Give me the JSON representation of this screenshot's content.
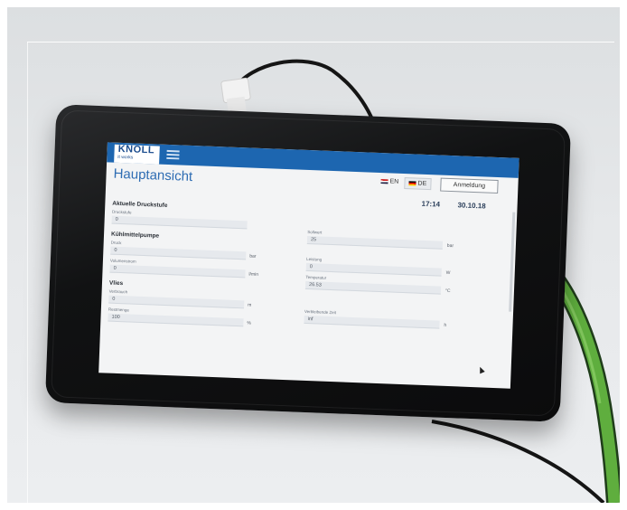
{
  "header": {
    "logo": "KNOLL",
    "logo_sub": "it works",
    "title": "Hauptansicht",
    "lang_en": "EN",
    "lang_de": "DE",
    "login": "Anmeldung",
    "time": "17:14",
    "date": "30.10.18"
  },
  "sections": {
    "druckstufe": "Aktuelle Druckstufe",
    "pumpe": "Kühlmittelpumpe",
    "vlies": "Vlies"
  },
  "left": {
    "druckstufe_label": "Druckstufe",
    "druckstufe_value": "0",
    "druck_label": "Druck",
    "druck_value": "0",
    "druck_unit": "bar",
    "volumen_label": "Volumenstrom",
    "volumen_value": "0",
    "volumen_unit": "l/min",
    "verbrauch_label": "Verbrauch",
    "verbrauch_value": "0",
    "verbrauch_unit": "m",
    "rest_label": "Restmenge",
    "rest_value": "100",
    "rest_unit": "%"
  },
  "right": {
    "sollwert_label": "Sollwert",
    "sollwert_value": "25",
    "sollwert_unit": "bar",
    "leistung_label": "Leistung",
    "leistung_value": "0",
    "leistung_unit": "W",
    "temp_label": "Temperatur",
    "temp_value": "26.53",
    "temp_unit": "°C",
    "zeit_label": "Verbleibende Zeit",
    "zeit_value": "inf",
    "zeit_unit": "h"
  },
  "colors": {
    "topbar": "#1d66b0",
    "cable_green": "#5fae3e",
    "tablet_body": "#111213"
  },
  "icons": [
    "menu-icon",
    "cursor-icon"
  ]
}
